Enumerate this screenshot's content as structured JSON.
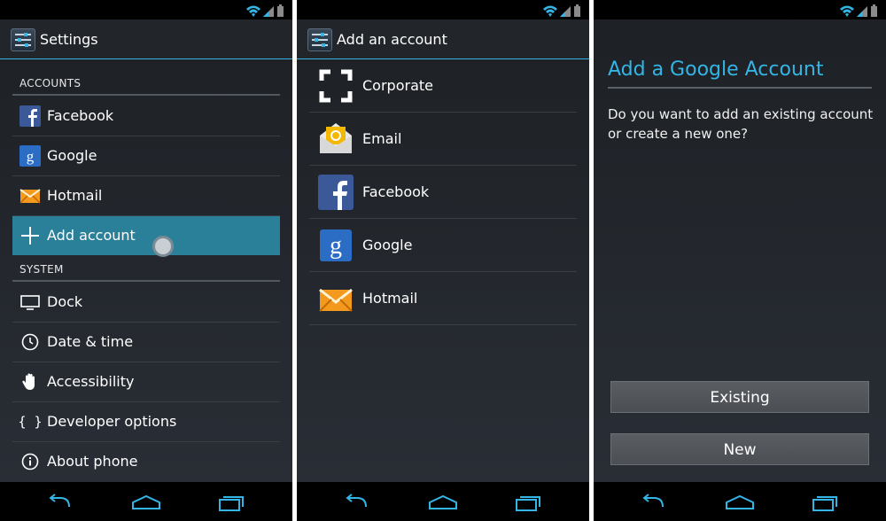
{
  "settings": {
    "title": "Settings",
    "accounts_header": "ACCOUNTS",
    "accounts": [
      {
        "label": "Facebook",
        "icon": "facebook-icon"
      },
      {
        "label": "Google",
        "icon": "google-icon"
      },
      {
        "label": "Hotmail",
        "icon": "hotmail-icon"
      },
      {
        "label": "Add account",
        "icon": "plus-icon",
        "highlighted": true
      }
    ],
    "system_header": "SYSTEM",
    "system": [
      {
        "label": "Dock",
        "icon": "monitor-icon"
      },
      {
        "label": "Date & time",
        "icon": "clock-icon"
      },
      {
        "label": "Accessibility",
        "icon": "hand-icon"
      },
      {
        "label": "Developer options",
        "icon": "braces-icon"
      },
      {
        "label": "About phone",
        "icon": "info-icon"
      }
    ]
  },
  "add_account": {
    "title": "Add an account",
    "items": [
      {
        "label": "Corporate",
        "icon": "corporate-icon"
      },
      {
        "label": "Email",
        "icon": "email-icon"
      },
      {
        "label": "Facebook",
        "icon": "facebook-icon"
      },
      {
        "label": "Google",
        "icon": "google-icon"
      },
      {
        "label": "Hotmail",
        "icon": "hotmail-icon"
      }
    ]
  },
  "google_dialog": {
    "title": "Add a Google Account",
    "message": "Do you want to add an existing account or create a new one?",
    "existing_label": "Existing",
    "new_label": "New"
  },
  "colors": {
    "accent": "#33b5e5",
    "highlight": "#2a7f99"
  }
}
